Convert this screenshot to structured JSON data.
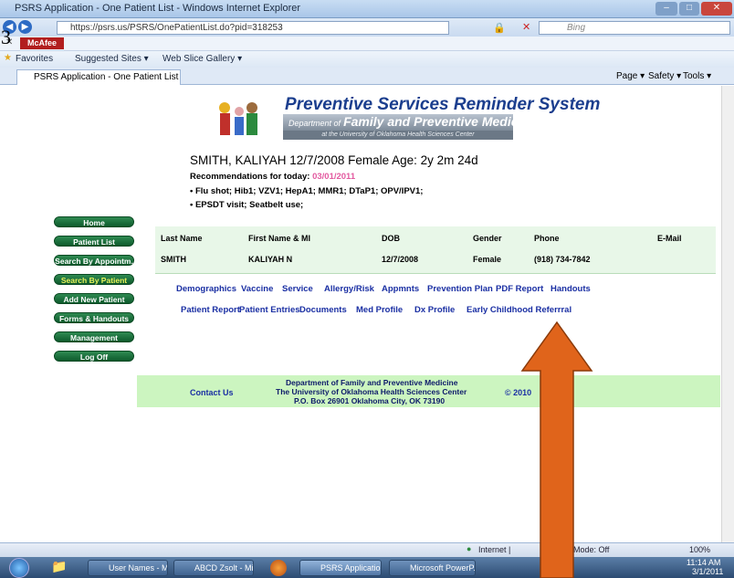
{
  "window": {
    "title": "PSRS Application - One Patient List - Windows Internet Explorer"
  },
  "browser": {
    "url": "https://psrs.us/PSRS/OnePatientList.do?pid=318253",
    "search_placeholder": "Bing",
    "toolbar_label": "McAfee",
    "favorites": {
      "label": "Favorites",
      "suggested": "Suggested Sites ▾",
      "gallery": "Web Slice Gallery ▾"
    },
    "tab_title": "PSRS Application - One Patient List",
    "commands": {
      "page": "Page ▾",
      "safety": "Safety ▾",
      "tools": "Tools ▾"
    }
  },
  "logo": {
    "title": "Preventive Services Reminder System",
    "dept_prefix": "Department of",
    "dept_name": "Family and Preventive Medicine",
    "sub": "at the University of Oklahoma Health Sciences Center"
  },
  "patient": {
    "header": "SMITH,  KALIYAH  12/7/2008  Female    Age: 2y 2m 24d",
    "rec_label": "Recommendations for today:",
    "rec_date": "03/01/2011",
    "recs": [
      "Flu shot; Hib1; VZV1; HepA1; MMR1; DTaP1; OPV/IPV1;",
      "EPSDT visit; Seatbelt use;"
    ]
  },
  "nav": [
    "Home",
    "Patient List",
    "Search By Appointm.",
    "Search By Patient",
    "Add New Patient",
    "Forms & Handouts",
    "Management",
    "Log Off"
  ],
  "table": {
    "headers": [
      "Last Name",
      "First Name & MI",
      "DOB",
      "Gender",
      "Phone",
      "E-Mail"
    ],
    "row": [
      "SMITH",
      "KALIYAH  N",
      "12/7/2008",
      "Female",
      "(918) 734-7842",
      ""
    ]
  },
  "links_row1": [
    "Demographics",
    "Vaccine",
    "Service",
    "Allergy/Risk",
    "Appmnts",
    "Prevention Plan",
    "PDF Report",
    "Handouts"
  ],
  "links_row2": [
    "Patient Report",
    "Patient Entries",
    "Documents",
    "Med Profile",
    "Dx Profile",
    "Early Childhood Referrral"
  ],
  "footer": {
    "contact": "Contact Us",
    "line1": "Department of Family and Preventive Medicine",
    "line2": "The University of Oklahoma Health Sciences Center",
    "line3": "P.O. Box 26901 Oklahoma City, OK 73190",
    "copyright": "© 2010"
  },
  "status": {
    "zone": "Internet |",
    "mode": "Mode: Off",
    "zoom": "100%"
  },
  "taskbar": {
    "items": [
      "User Names - Mic...",
      "ABCD Zsolt - Micr...",
      "PSRS Application ...",
      "Microsoft PowerP..."
    ],
    "time": "11:14 AM",
    "date": "3/1/2011"
  },
  "overlay": {
    "slide_char": "3",
    "arrow_color": "#e0641b"
  }
}
